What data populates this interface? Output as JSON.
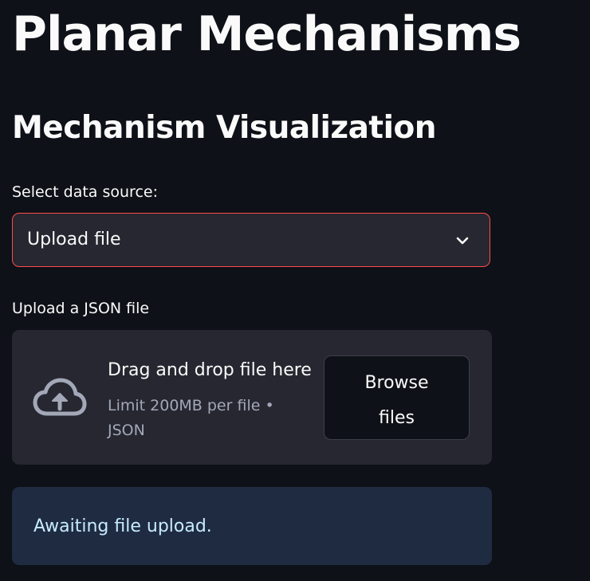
{
  "page": {
    "title": "Planar Mechanisms",
    "subtitle": "Mechanism Visualization"
  },
  "data_source": {
    "label": "Select data source:",
    "selected": "Upload file",
    "icon": "chevron-down-icon",
    "accent_color": "#ff4b4b"
  },
  "uploader": {
    "label": "Upload a JSON file",
    "drop_title": "Drag and drop file here",
    "limit_text": "Limit 200MB per file • JSON",
    "browse_label": "Browse files",
    "icon": "cloud-upload-icon"
  },
  "status": {
    "message": "Awaiting file upload.",
    "color": "#c7ebff",
    "background": "#1f2b40"
  }
}
